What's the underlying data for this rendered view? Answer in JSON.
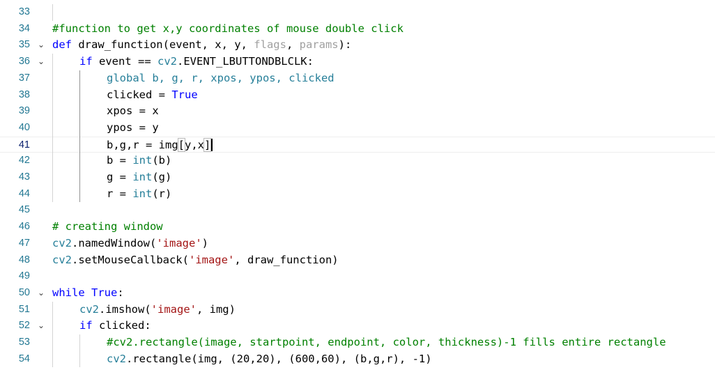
{
  "editor": {
    "active_line": "41",
    "lines": [
      {
        "num": "33",
        "tokens": []
      },
      {
        "num": "34",
        "tokens": [
          {
            "t": "#function to get x,y coordinates of mouse double click",
            "c": "cm"
          }
        ]
      },
      {
        "num": "35",
        "fold": "⌄",
        "tokens": [
          {
            "t": "def ",
            "c": "kw"
          },
          {
            "t": "draw_function(event, x, y, ",
            "c": "plain"
          },
          {
            "t": "flags",
            "c": "param"
          },
          {
            "t": ", ",
            "c": "plain"
          },
          {
            "t": "params",
            "c": "param"
          },
          {
            "t": "):",
            "c": "plain"
          }
        ]
      },
      {
        "num": "36",
        "fold": "⌄",
        "tokens": [
          {
            "t": "if ",
            "c": "kw"
          },
          {
            "t": "event == ",
            "c": "plain"
          },
          {
            "t": "cv2",
            "c": "mod"
          },
          {
            "t": ".EVENT_LBUTTONDBLCLK:",
            "c": "plain"
          }
        ]
      },
      {
        "num": "37",
        "tokens": [
          {
            "t": "global b, g, r, xpos, ypos, clicked",
            "c": "mod"
          }
        ]
      },
      {
        "num": "38",
        "tokens": [
          {
            "t": "clicked = ",
            "c": "plain"
          },
          {
            "t": "True",
            "c": "kw"
          }
        ]
      },
      {
        "num": "39",
        "tokens": [
          {
            "t": "xpos = x",
            "c": "plain"
          }
        ]
      },
      {
        "num": "40",
        "tokens": [
          {
            "t": "ypos = y",
            "c": "plain"
          }
        ]
      },
      {
        "num": "41",
        "tokens": [
          {
            "t": "b,g,r = img",
            "c": "plain"
          },
          {
            "t": "[",
            "c": "plain",
            "br": true
          },
          {
            "t": "y,x",
            "c": "plain"
          },
          {
            "t": "]",
            "c": "plain",
            "br": true
          }
        ]
      },
      {
        "num": "42",
        "tokens": [
          {
            "t": "b = ",
            "c": "plain"
          },
          {
            "t": "int",
            "c": "mod"
          },
          {
            "t": "(b)",
            "c": "plain"
          }
        ]
      },
      {
        "num": "43",
        "tokens": [
          {
            "t": "g = ",
            "c": "plain"
          },
          {
            "t": "int",
            "c": "mod"
          },
          {
            "t": "(g)",
            "c": "plain"
          }
        ]
      },
      {
        "num": "44",
        "tokens": [
          {
            "t": "r = ",
            "c": "plain"
          },
          {
            "t": "int",
            "c": "mod"
          },
          {
            "t": "(r)",
            "c": "plain"
          }
        ]
      },
      {
        "num": "45",
        "tokens": []
      },
      {
        "num": "46",
        "tokens": [
          {
            "t": "# creating window",
            "c": "cm"
          }
        ]
      },
      {
        "num": "47",
        "tokens": [
          {
            "t": "cv2",
            "c": "mod"
          },
          {
            "t": ".namedWindow(",
            "c": "plain"
          },
          {
            "t": "'image'",
            "c": "str"
          },
          {
            "t": ")",
            "c": "plain"
          }
        ]
      },
      {
        "num": "48",
        "tokens": [
          {
            "t": "cv2",
            "c": "mod"
          },
          {
            "t": ".setMouseCallback(",
            "c": "plain"
          },
          {
            "t": "'image'",
            "c": "str"
          },
          {
            "t": ", draw_function)",
            "c": "plain"
          }
        ]
      },
      {
        "num": "49",
        "tokens": []
      },
      {
        "num": "50",
        "fold": "⌄",
        "tokens": [
          {
            "t": "while ",
            "c": "kw"
          },
          {
            "t": "True",
            "c": "kw"
          },
          {
            "t": ":",
            "c": "plain"
          }
        ]
      },
      {
        "num": "51",
        "tokens": [
          {
            "t": "cv2",
            "c": "mod"
          },
          {
            "t": ".imshow(",
            "c": "plain"
          },
          {
            "t": "'image'",
            "c": "str"
          },
          {
            "t": ", img)",
            "c": "plain"
          }
        ]
      },
      {
        "num": "52",
        "fold": "⌄",
        "tokens": [
          {
            "t": "if ",
            "c": "kw"
          },
          {
            "t": "clicked:",
            "c": "plain"
          }
        ]
      },
      {
        "num": "53",
        "tokens": [
          {
            "t": "#cv2.rectangle(image, startpoint, endpoint, color, thickness)-1 fills entire rectangle",
            "c": "cm"
          }
        ]
      },
      {
        "num": "54",
        "tokens": [
          {
            "t": "cv2",
            "c": "mod"
          },
          {
            "t": ".rectangle(img, (20,20), (600,60), (b,g,r), -1)",
            "c": "plain"
          }
        ]
      }
    ]
  }
}
